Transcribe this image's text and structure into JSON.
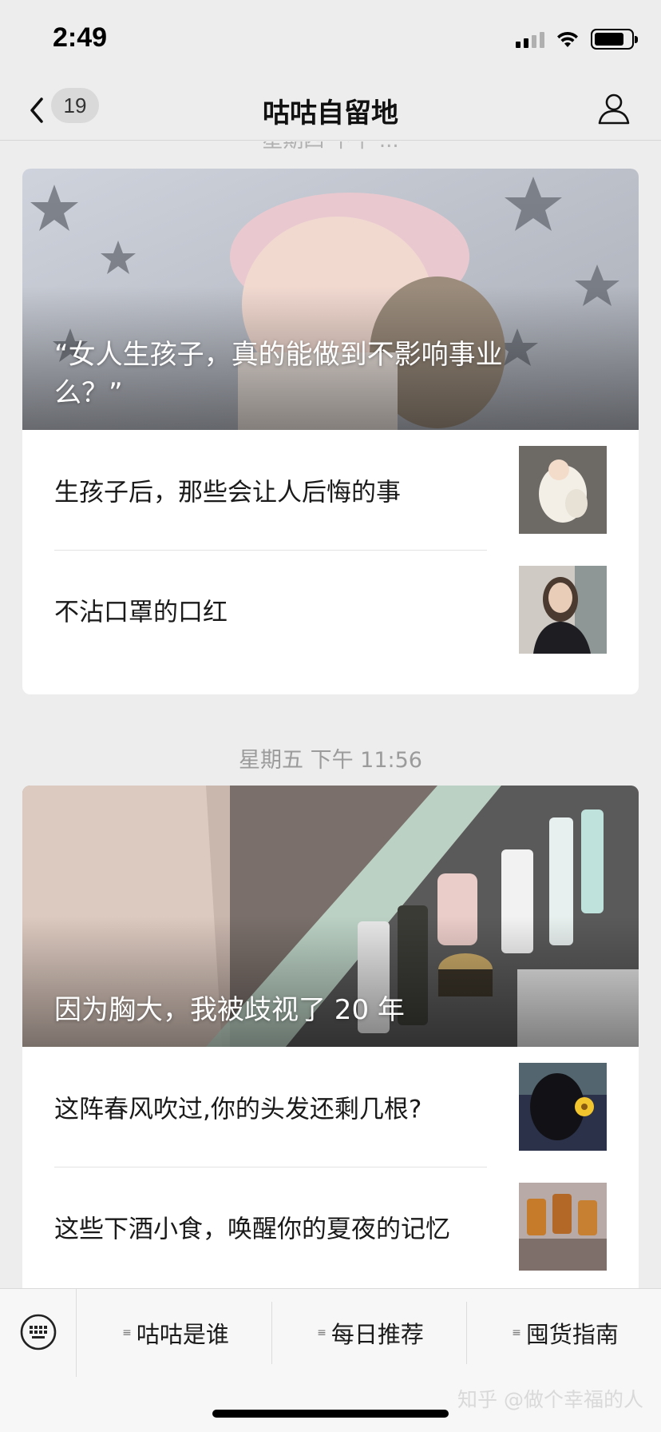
{
  "status_bar": {
    "time": "2:49"
  },
  "nav": {
    "unread_count": "19",
    "title": "咕咕自留地"
  },
  "feed": {
    "partial_date_header": "星期四 下午 ...",
    "groups": [
      {
        "hero_title": "“女人生孩子，真的能做到不影响事业么？”",
        "articles": [
          {
            "title": "生孩子后，那些会让人后悔的事"
          },
          {
            "title": "不沾口罩的口红"
          }
        ]
      },
      {
        "date": "星期五 下午 11:56",
        "hero_title": "因为胸大，我被歧视了 20 年",
        "articles": [
          {
            "title": "这阵春风吹过,你的头发还剩几根?"
          },
          {
            "title": "这些下酒小食，唤醒你的夏夜的记忆"
          }
        ]
      }
    ]
  },
  "bottom_menu": {
    "items": [
      {
        "label": "咕咕是谁"
      },
      {
        "label": "每日推荐"
      },
      {
        "label": "囤货指南"
      }
    ]
  },
  "watermark": "知乎 @做个幸福的人",
  "colors": {
    "background": "#ededed",
    "card": "#ffffff",
    "muted_text": "#9b9b9b"
  }
}
